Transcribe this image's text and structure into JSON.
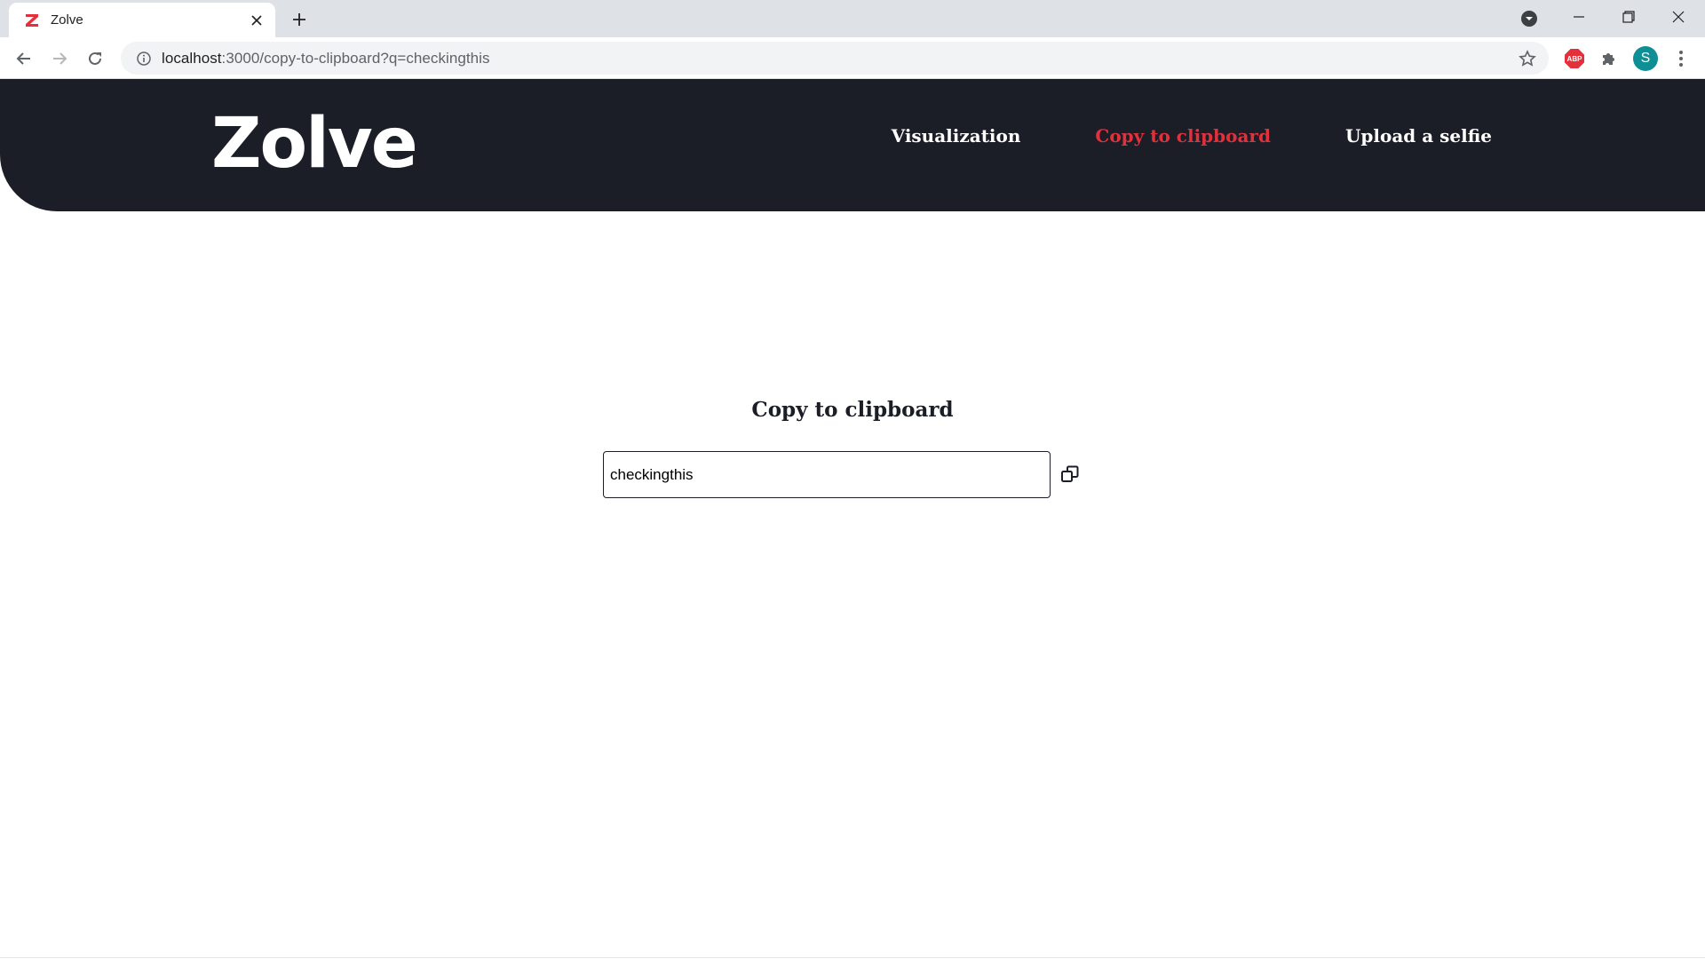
{
  "browser": {
    "tab": {
      "title": "Zolve",
      "favicon": "zolve-z-icon"
    },
    "url": {
      "host": "localhost",
      "path": ":3000/copy-to-clipboard?q=checkingthis"
    },
    "avatar_initial": "S",
    "adblock_label": "ABP"
  },
  "site": {
    "logo_text": "Zolve",
    "nav": [
      {
        "label": "Visualization",
        "active": false
      },
      {
        "label": "Copy to clipboard",
        "active": true
      },
      {
        "label": "Upload a selfie",
        "active": false
      }
    ],
    "colors": {
      "header_bg": "#1b1d27",
      "accent": "#e2313b"
    }
  },
  "main": {
    "title": "Copy to clipboard",
    "input_value": "checkingthis",
    "copy_icon": "copy-icon"
  }
}
